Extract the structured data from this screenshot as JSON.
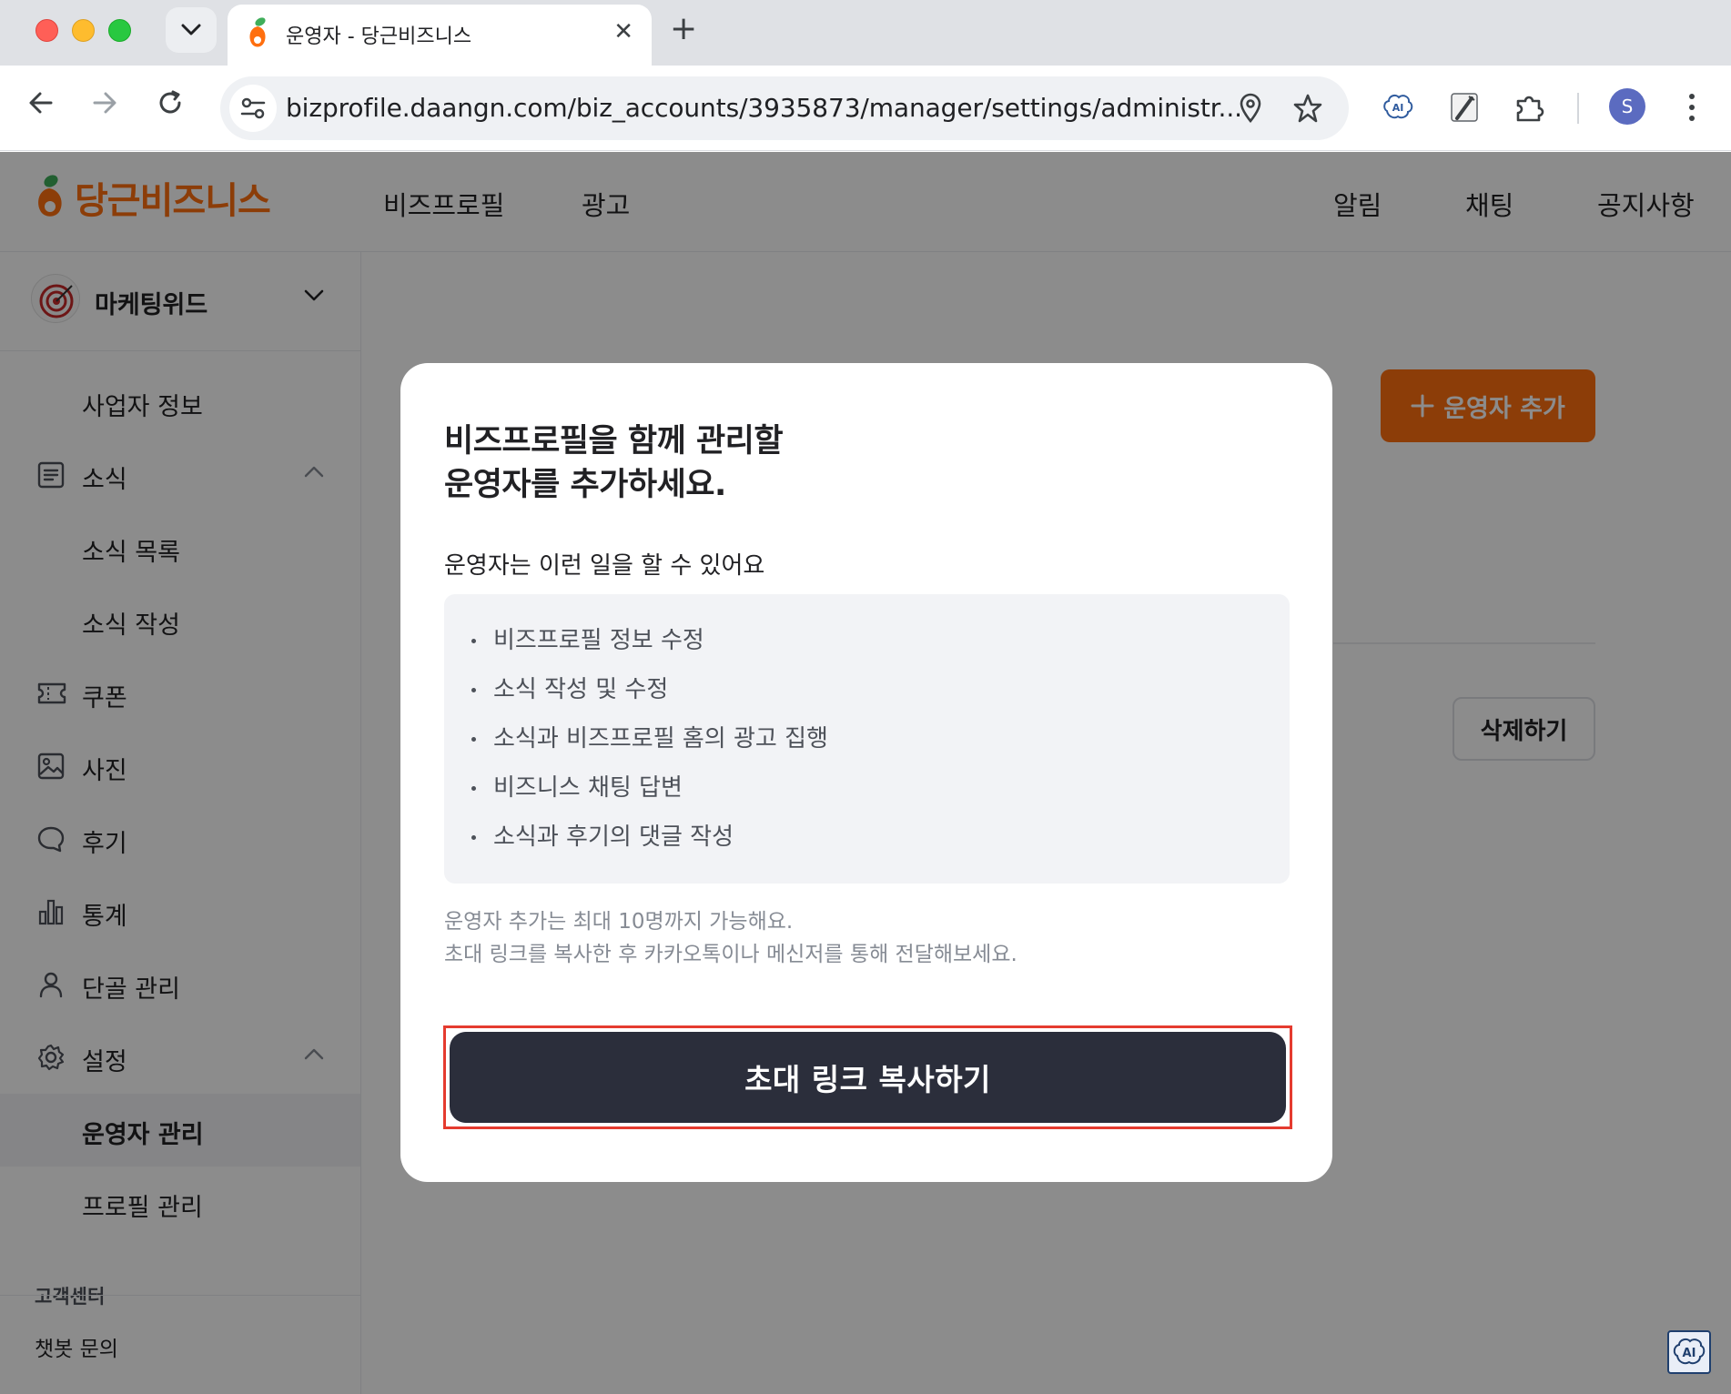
{
  "browser": {
    "tab_title": "운영자 - 당근비즈니스",
    "new_tab_symbol": "+",
    "close_symbol": "✕",
    "url": "bizprofile.daangn.com/biz_accounts/3935873/manager/settings/administr...",
    "profile_initial": "S"
  },
  "header": {
    "logo_text": "당근비즈니스",
    "nav_left": [
      "비즈프로필",
      "광고"
    ],
    "nav_right": [
      "알림",
      "채팅",
      "공지사항"
    ],
    "brand_color": "#ff6f0f"
  },
  "sidebar": {
    "account_name": "마케팅위드",
    "items": [
      {
        "label": "사업자 정보",
        "icon": "none"
      },
      {
        "label": "소식",
        "icon": "news-icon"
      },
      {
        "label": "소식 목록",
        "icon": "none"
      },
      {
        "label": "소식 작성",
        "icon": "none"
      },
      {
        "label": "쿠폰",
        "icon": "coupon-icon"
      },
      {
        "label": "사진",
        "icon": "photo-icon"
      },
      {
        "label": "후기",
        "icon": "review-icon"
      },
      {
        "label": "통계",
        "icon": "stats-icon"
      },
      {
        "label": "단골 관리",
        "icon": "person-icon"
      },
      {
        "label": "설정",
        "icon": "gear-icon"
      },
      {
        "label": "운영자 관리",
        "icon": "none"
      },
      {
        "label": "프로필 관리",
        "icon": "none"
      }
    ],
    "customer_center": "고객센터",
    "chatbot": "챗봇 문의"
  },
  "main": {
    "add_operator_label": "운영자 추가",
    "delete_label": "삭제하기"
  },
  "modal": {
    "title_line1": "비즈프로필을 함께 관리할",
    "title_line2": "운영자를 추가하세요.",
    "subtitle": "운영자는 이런 일을 할 수 있어요",
    "abilities": [
      "비즈프로필 정보 수정",
      "소식 작성 및 수정",
      "소식과 비즈프로필 홈의 광고 집행",
      "비즈니스 채팅 답변",
      "소식과 후기의 댓글 작성"
    ],
    "note_line1": "운영자 추가는 최대 10명까지 가능해요.",
    "note_line2": "초대 링크를 복사한 후 카카오톡이나 메신저를 통해 전달해보세요.",
    "cta_label": "초대 링크 복사하기"
  },
  "ai_badge": "AI"
}
